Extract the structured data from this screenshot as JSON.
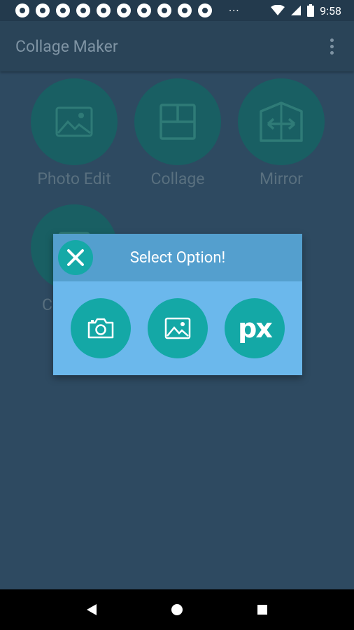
{
  "status_bar": {
    "notification_icons": [
      "chrome-icon",
      "chrome-icon",
      "chrome-icon",
      "chrome-icon",
      "chrome-icon",
      "chrome-icon",
      "chrome-icon",
      "chrome-icon",
      "chrome-icon",
      "chrome-icon"
    ],
    "more_indicator": "···",
    "time": "9:58"
  },
  "app_bar": {
    "title": "Collage Maker",
    "overflow_icon": "more-vert-icon"
  },
  "tiles": [
    {
      "label": "Photo Edit",
      "icon": "image-icon"
    },
    {
      "label": "Collage",
      "icon": "grid-icon"
    },
    {
      "label": "Mirror",
      "icon": "mirror-icon"
    },
    {
      "label": "C",
      "icon": "document-icon"
    }
  ],
  "dialog": {
    "title": "Select Option!",
    "close_icon": "close-icon",
    "options": [
      {
        "icon": "camera-icon"
      },
      {
        "icon": "gallery-icon"
      },
      {
        "icon": "pixabay-icon",
        "text": "px"
      }
    ]
  },
  "nav_bar": {
    "buttons": [
      "back-icon",
      "home-icon",
      "recents-icon"
    ]
  },
  "colors": {
    "background": "#2e4a61",
    "app_bar": "#2a4458",
    "tile": "#195f63",
    "dialog_header": "#549fce",
    "dialog_body": "#6bb8ec",
    "accent": "#14a8a6"
  }
}
